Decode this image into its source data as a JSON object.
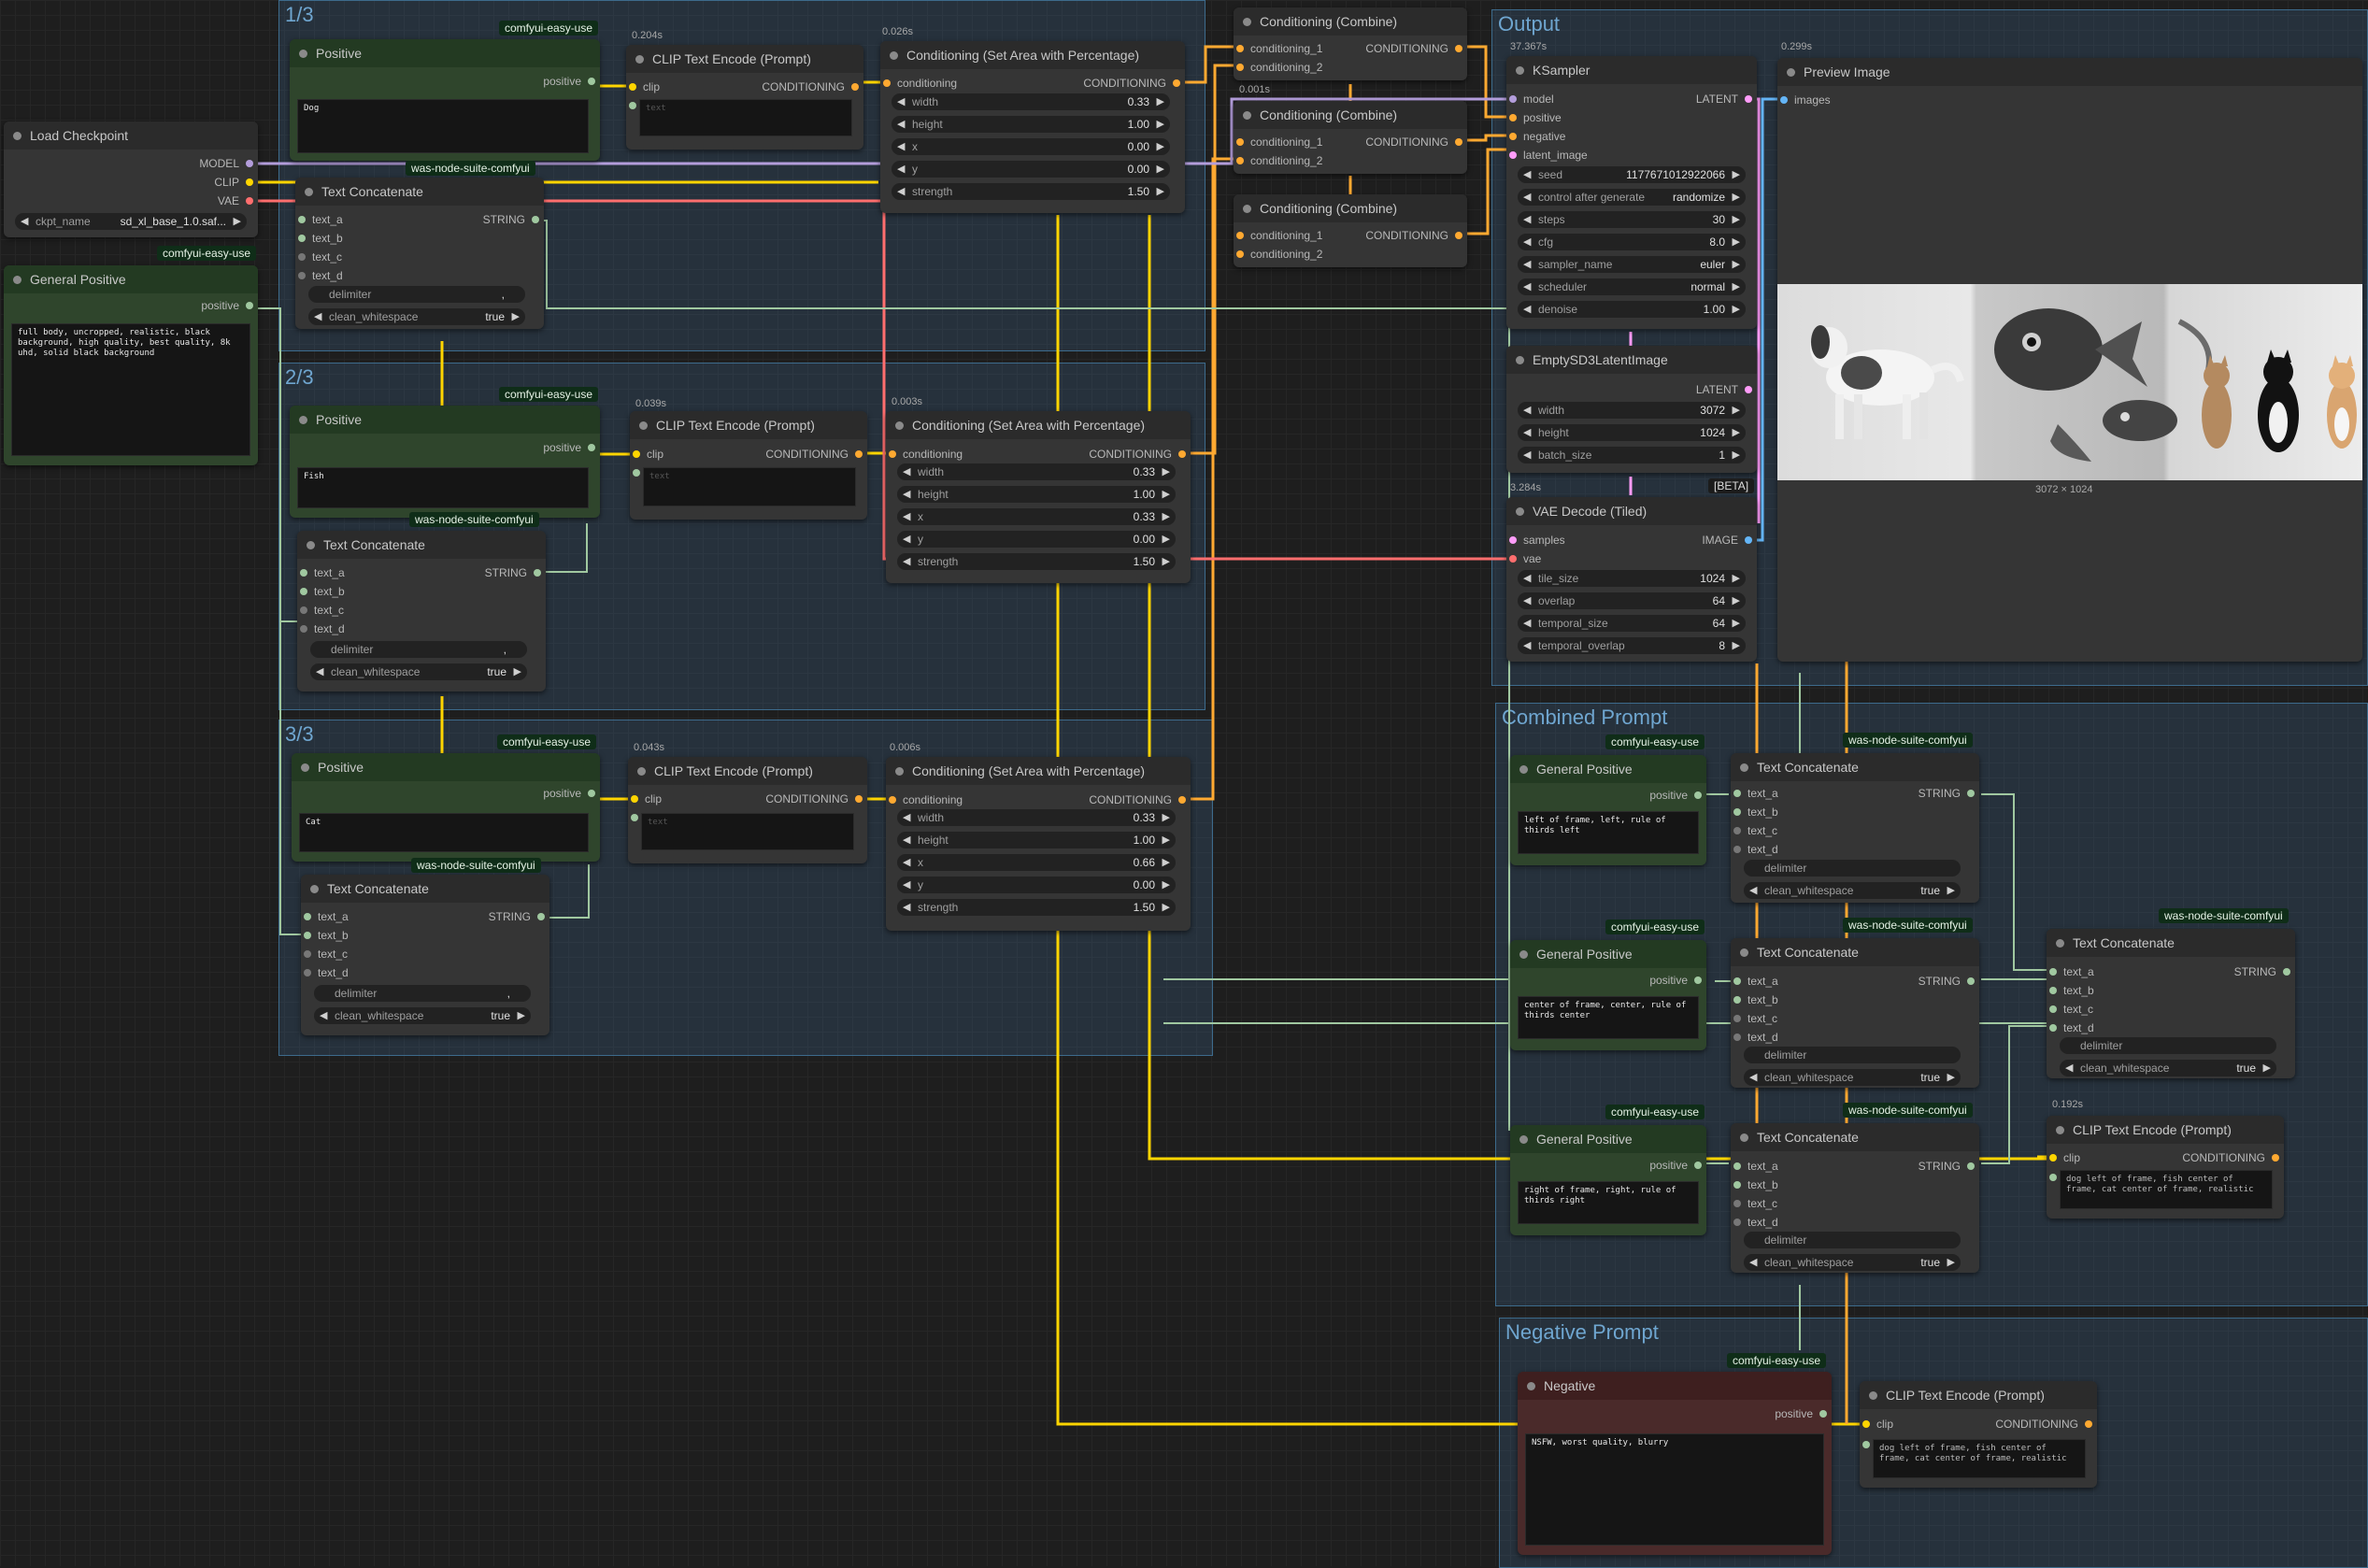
{
  "groups": {
    "g1": "1/3",
    "g2": "2/3",
    "g3": "3/3",
    "output": "Output",
    "combined": "Combined Prompt",
    "negative": "Negative Prompt"
  },
  "badges": {
    "easy_use": "comfyui-easy-use",
    "was_suite": "was-node-suite-comfyui",
    "beta": "[BETA]"
  },
  "load_checkpoint": {
    "title": "Load Checkpoint",
    "outputs": [
      "MODEL",
      "CLIP",
      "VAE"
    ],
    "ckpt_label": "ckpt_name",
    "ckpt_value": "sd_xl_base_1.0.saf..."
  },
  "general_positive_main": {
    "title": "General Positive",
    "output": "positive",
    "text": "full body, uncropped, realistic, black background, high quality, best quality, 8k uhd, solid black background"
  },
  "positive1": {
    "title": "Positive",
    "output": "positive",
    "text": "Dog"
  },
  "positive2": {
    "title": "Positive",
    "output": "positive",
    "text": "Fish"
  },
  "positive3": {
    "title": "Positive",
    "output": "positive",
    "text": "Cat"
  },
  "text_concat": {
    "title": "Text Concatenate",
    "inputs": [
      "text_a",
      "text_b",
      "text_c",
      "text_d"
    ],
    "output": "STRING",
    "delimiter_label": "delimiter",
    "delimiter_value": ",",
    "clean_label": "clean_whitespace",
    "clean_value": "true"
  },
  "clip_encode": {
    "title": "CLIP Text Encode (Prompt)",
    "input": "clip",
    "output": "CONDITIONING",
    "placeholder": "text"
  },
  "timings": {
    "clip1": "0.204s",
    "setarea1": "0.026s",
    "clip2": "0.039s",
    "setarea2": "0.003s",
    "clip3": "0.043s",
    "setarea3": "0.006s",
    "combine1": "0.001s",
    "ksampler": "37.367s",
    "preview": "0.299s",
    "vae": "3.284s",
    "clip_final": "0.192s"
  },
  "set_area": {
    "title": "Conditioning (Set Area with Percentage)",
    "input": "conditioning",
    "output": "CONDITIONING",
    "labels": [
      "width",
      "height",
      "x",
      "y",
      "strength"
    ],
    "values1": [
      "0.33",
      "1.00",
      "0.00",
      "0.00",
      "1.50"
    ],
    "values2": [
      "0.33",
      "1.00",
      "0.33",
      "0.00",
      "1.50"
    ],
    "values3": [
      "0.33",
      "1.00",
      "0.66",
      "0.00",
      "1.50"
    ]
  },
  "combine": {
    "title": "Conditioning (Combine)",
    "inputs": [
      "conditioning_1",
      "conditioning_2"
    ],
    "output": "CONDITIONING"
  },
  "ksampler": {
    "title": "KSampler",
    "inputs": [
      "model",
      "positive",
      "negative",
      "latent_image"
    ],
    "output": "LATENT",
    "widgets": [
      {
        "label": "seed",
        "value": "1177671012922066"
      },
      {
        "label": "control after generate",
        "value": "randomize"
      },
      {
        "label": "steps",
        "value": "30"
      },
      {
        "label": "cfg",
        "value": "8.0"
      },
      {
        "label": "sampler_name",
        "value": "euler"
      },
      {
        "label": "scheduler",
        "value": "normal"
      },
      {
        "label": "denoise",
        "value": "1.00"
      }
    ]
  },
  "empty_latent": {
    "title": "EmptySD3LatentImage",
    "output": "LATENT",
    "widgets": [
      {
        "label": "width",
        "value": "3072"
      },
      {
        "label": "height",
        "value": "1024"
      },
      {
        "label": "batch_size",
        "value": "1"
      }
    ]
  },
  "vae_decode": {
    "title": "VAE Decode (Tiled)",
    "inputs": [
      "samples",
      "vae"
    ],
    "output": "IMAGE",
    "widgets": [
      {
        "label": "tile_size",
        "value": "1024"
      },
      {
        "label": "overlap",
        "value": "64"
      },
      {
        "label": "temporal_size",
        "value": "64"
      },
      {
        "label": "temporal_overlap",
        "value": "8"
      }
    ]
  },
  "preview_image": {
    "title": "Preview Image",
    "input": "images",
    "caption": "3072 × 1024"
  },
  "combined_prompts": {
    "left": "left of frame, left, rule of thirds left",
    "center": "center of frame, center, rule of thirds center",
    "right": "right of frame, right, rule of thirds right"
  },
  "final_clip_text": "dog left of frame, fish center of frame, cat center of frame, realistic",
  "negative_node": {
    "title": "Negative",
    "output": "positive",
    "text": "NSFW, worst quality, blurry"
  },
  "colors": {
    "clip": "#ffd500",
    "model": "#b39ddb",
    "vae": "#ff6e6e",
    "conditioning": "#ffa931",
    "latent": "#ff9cf9",
    "image": "#64b5f6",
    "string": "#a0c8a0"
  }
}
